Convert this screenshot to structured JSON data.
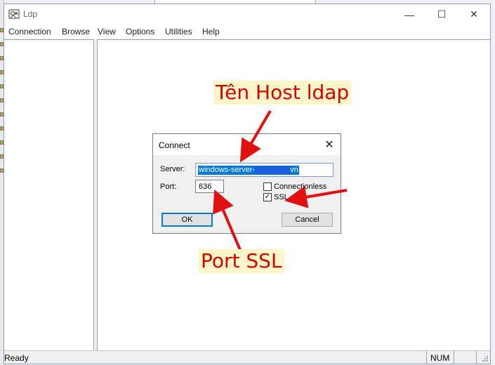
{
  "window": {
    "title": "Ldp",
    "minimize": "—",
    "maximize": "☐",
    "close": "✕"
  },
  "menu": {
    "items": [
      "Connection",
      "Browse",
      "View",
      "Options",
      "Utilities",
      "Help"
    ]
  },
  "status": {
    "text": "Ready",
    "num": "NUM"
  },
  "dialog": {
    "title": "Connect",
    "server_label": "Server:",
    "server_value": "windows-server-",
    "server_suffix": "vn",
    "port_label": "Port:",
    "port_value": "636",
    "connectionless_label": "Connectionless",
    "connectionless_checked": false,
    "ssl_label": "SSL",
    "ssl_checked": true,
    "ok_label": "OK",
    "cancel_label": "Cancel"
  },
  "annotations": {
    "host": "Tên Host ldap",
    "port": "Port SSL"
  },
  "colors": {
    "annotation_text": "#d40000",
    "annotation_bg": "#fdf6c8",
    "selection": "#0078d7",
    "redaction": "#1a5fe0"
  }
}
